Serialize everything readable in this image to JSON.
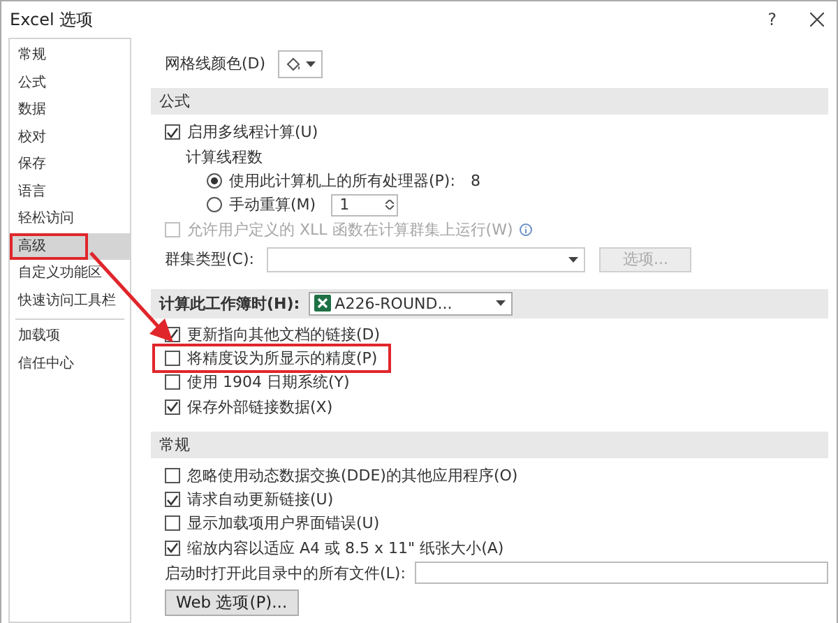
{
  "window": {
    "title": "Excel 选项",
    "help": "?"
  },
  "sidebar": {
    "groups": [
      [
        {
          "label": "常规",
          "selected": false,
          "highlighted": false
        },
        {
          "label": "公式",
          "selected": false,
          "highlighted": false
        },
        {
          "label": "数据",
          "selected": false,
          "highlighted": false
        },
        {
          "label": "校对",
          "selected": false,
          "highlighted": false
        },
        {
          "label": "保存",
          "selected": false,
          "highlighted": false
        },
        {
          "label": "语言",
          "selected": false,
          "highlighted": false
        },
        {
          "label": "轻松访问",
          "selected": false,
          "highlighted": false
        },
        {
          "label": "高级",
          "selected": true,
          "highlighted": true
        },
        {
          "label": "自定义功能区",
          "selected": false,
          "highlighted": false
        },
        {
          "label": "快速访问工具栏",
          "selected": false,
          "highlighted": false
        }
      ],
      [
        {
          "label": "加载项",
          "selected": false,
          "highlighted": false
        },
        {
          "label": "信任中心",
          "selected": false,
          "highlighted": false
        }
      ]
    ]
  },
  "content": {
    "rows": [
      {
        "kind": "color",
        "label": "网格线颜色(D)"
      },
      {
        "kind": "section",
        "label": "公式"
      },
      {
        "kind": "checkbox",
        "label": "启用多线程计算(U)",
        "checked": true,
        "disabled": false,
        "children": [
          {
            "kind": "text",
            "label": "计算线程数",
            "children": [
              {
                "kind": "radio",
                "label": "使用此计算机上的所有处理器(P):",
                "value": "8",
                "selected": true
              },
              {
                "kind": "radio",
                "label": "手动重算(M)",
                "spinner": "1",
                "selected": false
              }
            ]
          }
        ]
      },
      {
        "kind": "checkbox",
        "label": "允许用户定义的 XLL 函数在计算群集上运行(W)",
        "checked": false,
        "disabled": true,
        "info": true
      },
      {
        "kind": "dropdown",
        "label": "群集类型(C):",
        "button": "选项...",
        "disabled": true
      },
      {
        "kind": "workbook",
        "label": "计算此工作簿时(H):",
        "value": "A226-ROUND..."
      },
      {
        "kind": "checkbox",
        "label": "更新指向其他文档的链接(D)",
        "checked": true,
        "disabled": false
      },
      {
        "kind": "checkbox",
        "label": "将精度设为所显示的精度(P)",
        "checked": false,
        "disabled": false,
        "highlighted": true
      },
      {
        "kind": "checkbox",
        "label": "使用 1904 日期系统(Y)",
        "checked": false,
        "disabled": false
      },
      {
        "kind": "checkbox",
        "label": "保存外部链接数据(X)",
        "checked": true,
        "disabled": false
      },
      {
        "kind": "section",
        "label": "常规"
      },
      {
        "kind": "checkbox",
        "label": "忽略使用动态数据交换(DDE)的其他应用程序(O)",
        "checked": false,
        "disabled": false
      },
      {
        "kind": "checkbox",
        "label": "请求自动更新链接(U)",
        "checked": true,
        "disabled": false
      },
      {
        "kind": "checkbox",
        "label": "显示加载项用户界面错误(U)",
        "checked": false,
        "disabled": false
      },
      {
        "kind": "checkbox",
        "label": "缩放内容以适应 A4 或 8.5 x 11\" 纸张大小(A)",
        "checked": true,
        "disabled": false
      },
      {
        "kind": "field",
        "label": "启动时打开此目录中的所有文件(L):"
      },
      {
        "kind": "button",
        "label": "Web 选项(P)..."
      }
    ]
  }
}
